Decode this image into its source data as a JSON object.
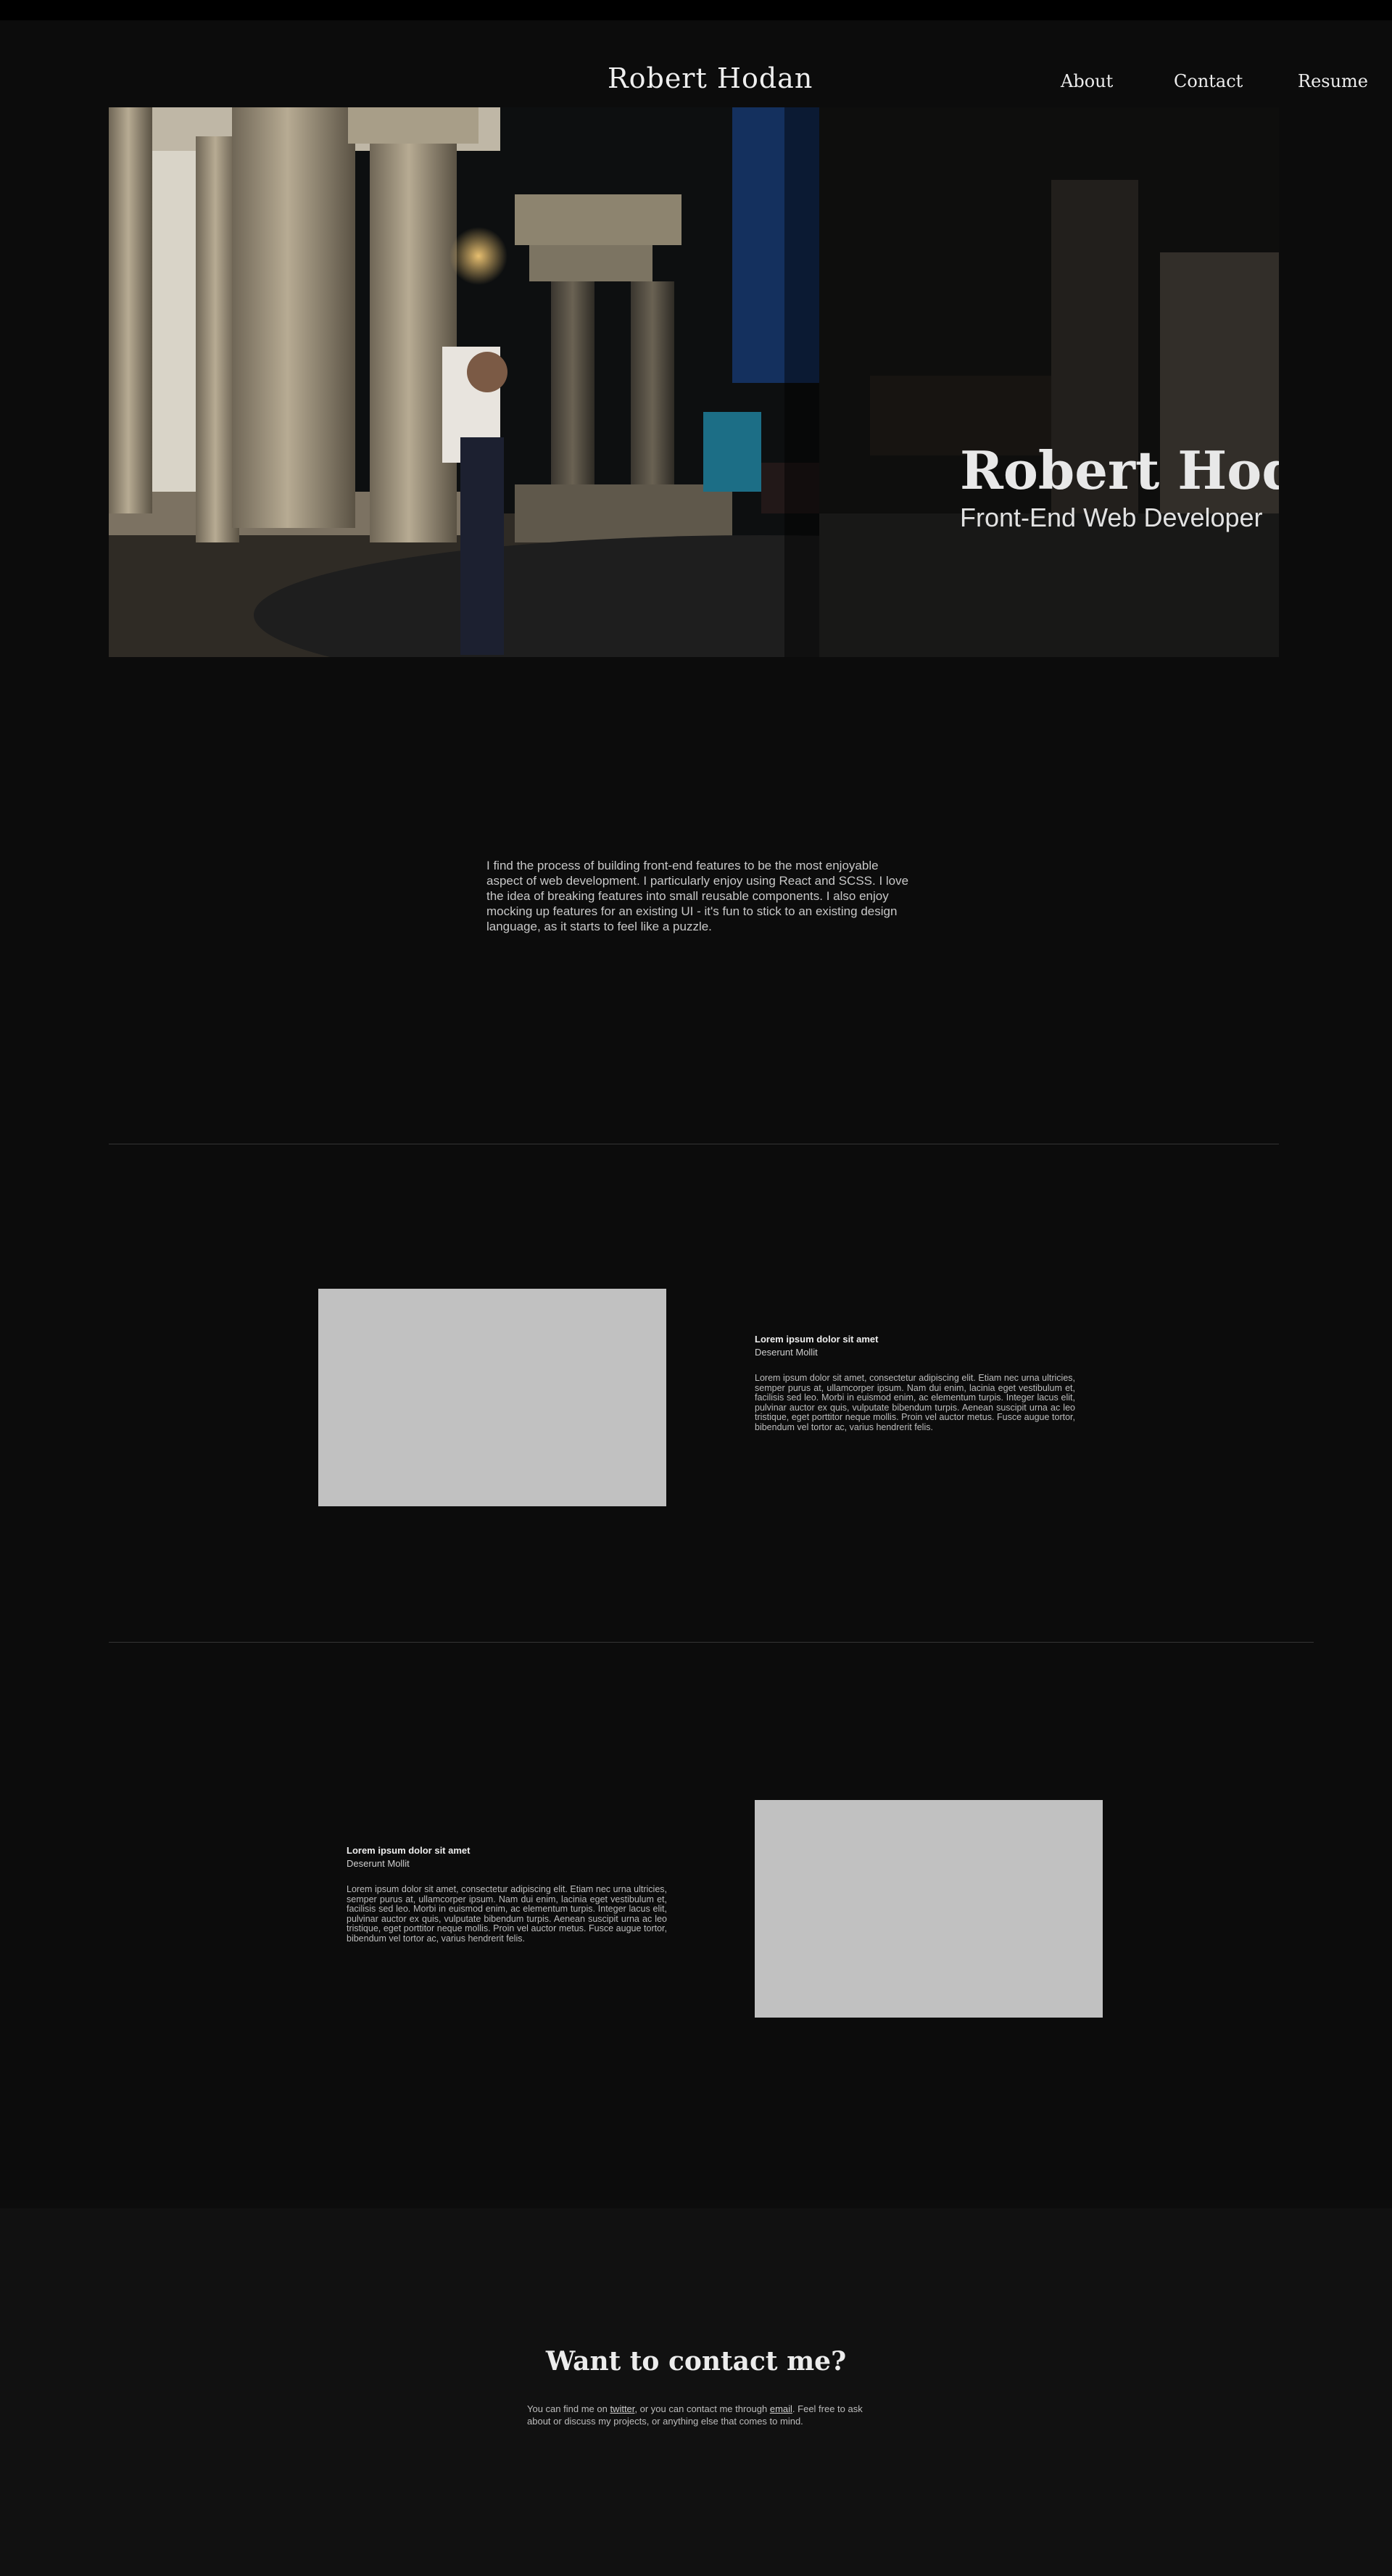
{
  "header": {
    "brand": "Robert Hodan",
    "nav": [
      "About",
      "Contact",
      "Resume"
    ]
  },
  "hero": {
    "title": "Robert Hodan",
    "subtitle": "Front-End Web Developer"
  },
  "intro": {
    "text": "I find the process of building front-end features to be the most enjoyable aspect of web development. I particularly enjoy using React and SCSS. I love the idea of breaking features into small reusable components. I also enjoy mocking up features for an existing UI - it's fun to stick to an existing design language, as it starts to feel like a puzzle."
  },
  "projects": [
    {
      "title": "Lorem ipsum dolor sit amet",
      "subtitle": "Deserunt Mollit",
      "body": "Lorem ipsum dolor sit amet, consectetur adipiscing elit. Etiam nec urna ultricies, semper purus at, ullamcorper ipsum. Nam dui enim, lacinia eget vestibulum et, facilisis sed leo. Morbi in euismod enim, ac elementum turpis. Integer lacus elit, pulvinar auctor ex quis, vulputate bibendum turpis. Aenean suscipit urna ac leo tristique, eget porttitor neque mollis. Proin vel auctor metus. Fusce augue tortor, bibendum vel tortor ac, varius hendrerit felis."
    },
    {
      "title": "Lorem ipsum dolor sit amet",
      "subtitle": "Deserunt Mollit",
      "body": "Lorem ipsum dolor sit amet, consectetur adipiscing elit. Etiam nec urna ultricies, semper purus at, ullamcorper ipsum. Nam dui enim, lacinia eget vestibulum et, facilisis sed leo. Morbi in euismod enim, ac elementum turpis. Integer lacus elit, pulvinar auctor ex quis, vulputate bibendum turpis. Aenean suscipit urna ac leo tristique, eget porttitor neque mollis. Proin vel auctor metus. Fusce augue tortor, bibendum vel tortor ac, varius hendrerit felis."
    }
  ],
  "contact": {
    "title": "Want to contact me?",
    "text_before": "You can find me on ",
    "twitter_link": "twitter",
    "text_middle": ", or you can contact me through ",
    "email_link": "email",
    "text_after": ". Feel free to ask about or discuss my projects, or anything else that comes to mind."
  }
}
